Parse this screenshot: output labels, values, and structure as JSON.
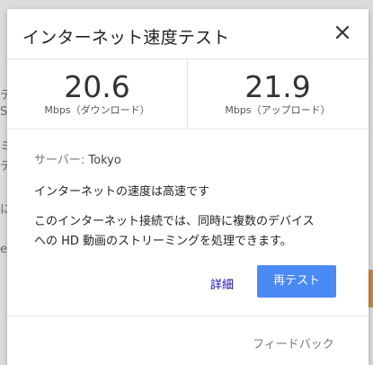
{
  "background": {
    "fragments": [
      "テ",
      "S",
      "ミ",
      "テ",
      "に",
      "e"
    ],
    "accent_color": "#c9873f"
  },
  "dialog": {
    "title": "インターネット速度テスト",
    "close_icon": "close-icon",
    "download": {
      "value": "20.6",
      "unit": "Mbps（ダウンロード）"
    },
    "upload": {
      "value": "21.9",
      "unit": "Mbps（アップロード）"
    },
    "server_label": "サーバー:",
    "server_value": "Tokyo",
    "status": "インターネットの速度は高速です",
    "description_line1": "このインターネット接続では、同時に複数のデバイス",
    "description_line2": "への HD 動画のストリーミングを処理できます。",
    "detail_link": "詳細",
    "retest_button": "再テスト",
    "feedback": "フィードバック",
    "accent_color": "#4a8af4",
    "link_color": "#1a0dab"
  }
}
